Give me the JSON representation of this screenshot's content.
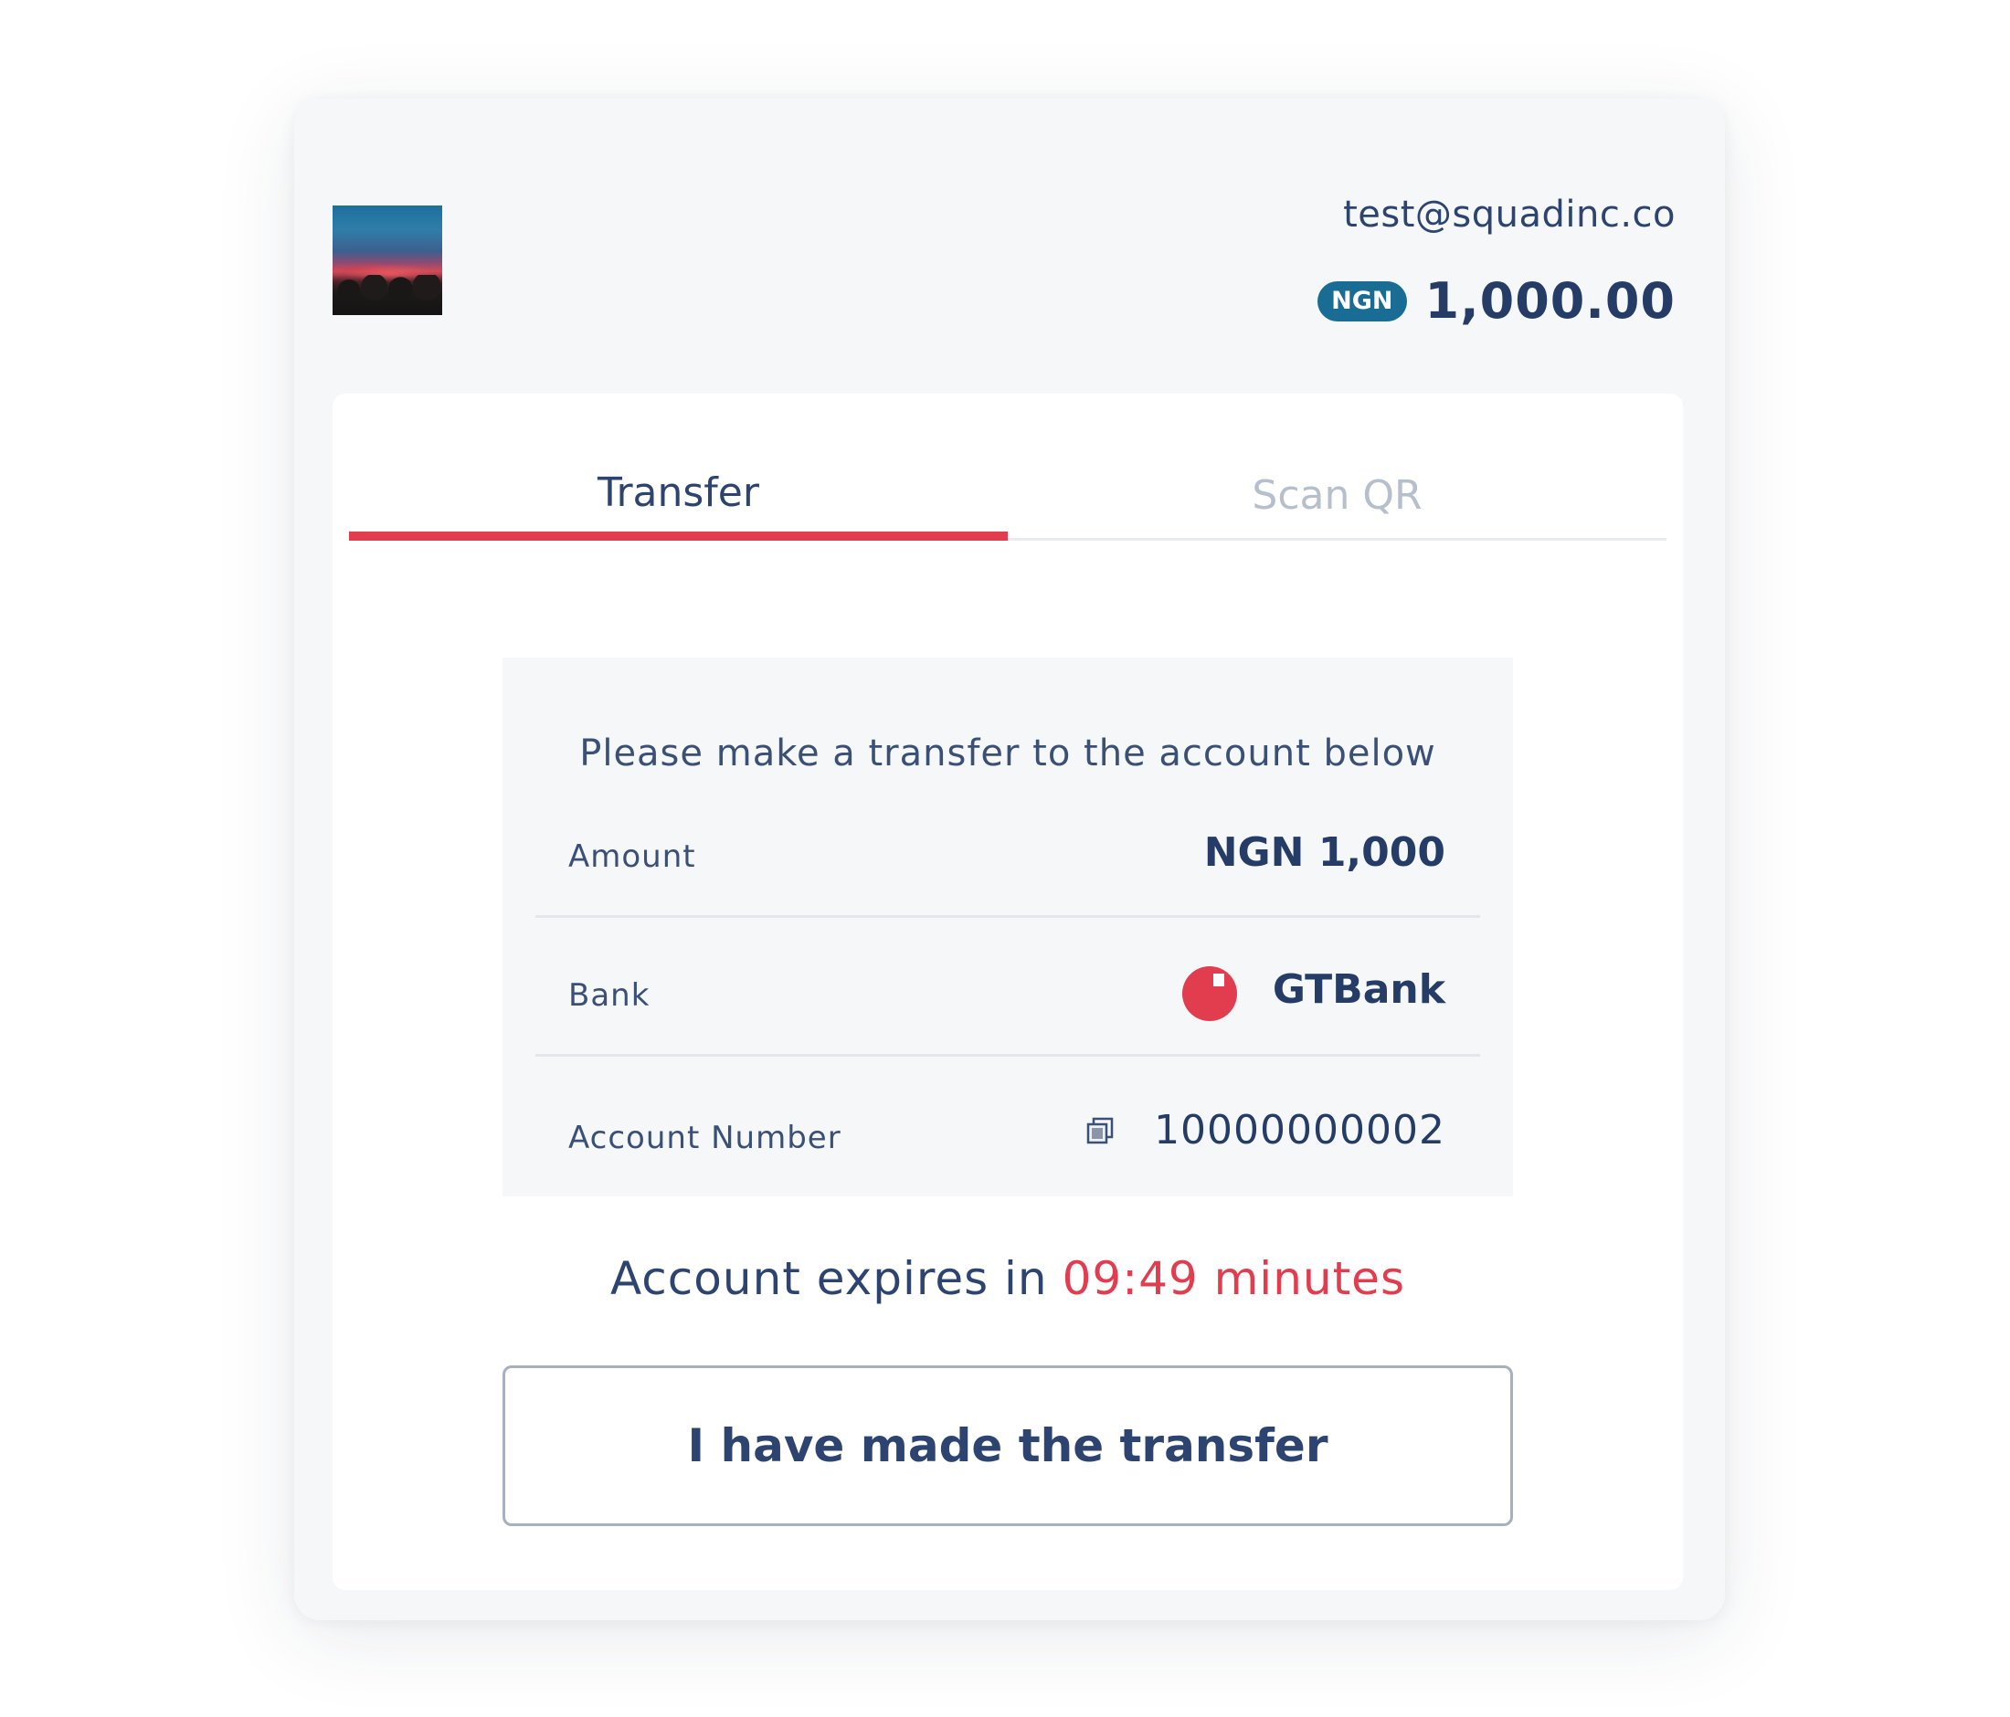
{
  "header": {
    "merchant_email": "test@squadinc.co",
    "currency_badge": "NGN",
    "amount": "1,000.00"
  },
  "tabs": [
    {
      "label": "Transfer",
      "active": true
    },
    {
      "label": "Scan QR",
      "active": false
    }
  ],
  "transfer": {
    "instruction": "Please make a transfer to the account below",
    "amount": {
      "label": "Amount",
      "value": "NGN 1,000"
    },
    "bank": {
      "label": "Bank",
      "value": "GTBank",
      "logo_color": "#e23d4f"
    },
    "account_number": {
      "label": "Account Number",
      "value": "10000000002"
    }
  },
  "expiry": {
    "label": "Account expires in",
    "time": "09:49 minutes"
  },
  "confirm_button_label": "I have made the transfer",
  "colors": {
    "accent": "#e23d4f",
    "badge": "#196d94",
    "text": "#2d4470"
  },
  "icons": {
    "merchant_logo": "merchant-logo-image",
    "bank_logo": "gtbank-logo-icon",
    "copy": "copy-icon"
  }
}
